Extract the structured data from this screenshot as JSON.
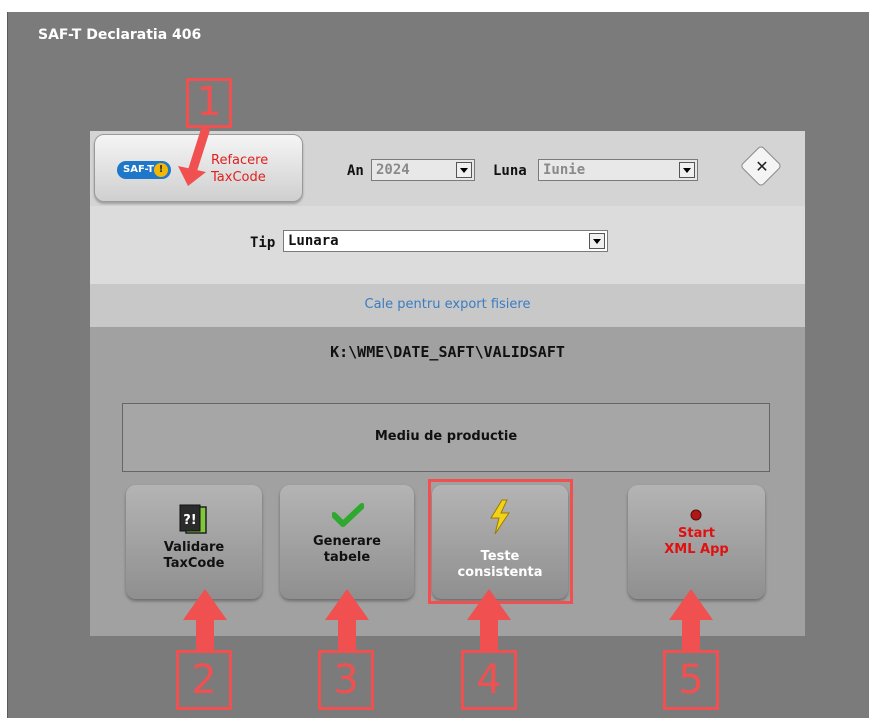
{
  "window": {
    "title": "SAF-T Declaratia 406"
  },
  "header": {
    "saft_logo_text": "SAF-T",
    "saft_logo_excl": "!",
    "refacere_line1": "Refacere",
    "refacere_line2": "TaxCode",
    "an_label": "An",
    "an_value": "2024",
    "luna_label": "Luna",
    "luna_value": "Iunie",
    "close_glyph": "✕"
  },
  "tip": {
    "label": "Tip",
    "value": "Lunara"
  },
  "export": {
    "caption": "Cale pentru export fisiere",
    "path": "K:\\WME\\DATE_SAFT\\VALIDSAFT"
  },
  "mediu": {
    "text": "Mediu de productie"
  },
  "actions": [
    {
      "line1": "Validare",
      "line2": "TaxCode",
      "icon": "document-question-icon"
    },
    {
      "line1": "Generare",
      "line2": "tabele",
      "icon": "checkmark-icon"
    },
    {
      "line1": "Teste",
      "line2": "consistenta",
      "icon": "lightning-icon"
    },
    {
      "line1": "Start",
      "line2": "XML App",
      "icon": "red-dot-icon"
    }
  ],
  "annotations": [
    "1",
    "2",
    "3",
    "4",
    "5"
  ],
  "colors": {
    "annotation": "#f05050",
    "refacere": "#e02020",
    "start_xml": "#e01010",
    "cale_link": "#3a7cc1",
    "saft_logo": "#1f77c9"
  }
}
